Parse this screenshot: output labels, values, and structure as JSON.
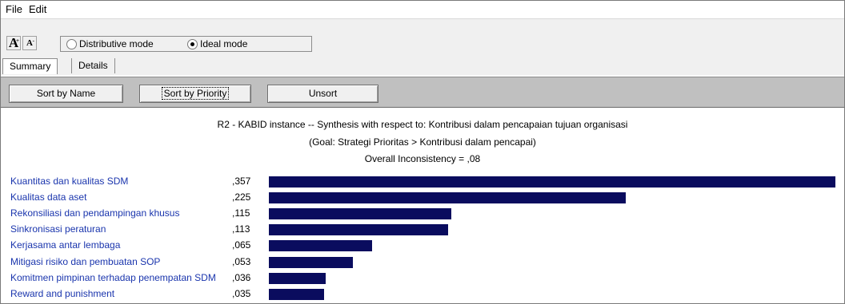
{
  "menu": {
    "file": "File",
    "edit": "Edit"
  },
  "toolbar": {
    "font_increase_icon": "A-increase-font-icon",
    "font_decrease_icon": "A-decrease-font-icon",
    "mode_distributive": "Distributive mode",
    "mode_ideal": "Ideal mode",
    "selected_mode": "Ideal mode"
  },
  "tabs": {
    "summary": "Summary",
    "details": "Details",
    "active": "Summary"
  },
  "sort": {
    "by_name": "Sort by Name",
    "by_priority": "Sort by Priority",
    "unsort": "Unsort"
  },
  "header": {
    "line1": "R2 - KABID instance -- Synthesis with respect to: Kontribusi dalam pencapaian tujuan organisasi",
    "line2": "(Goal: Strategi Prioritas  > Kontribusi dalam pencapai)",
    "line3": "Overall Inconsistency = ,08"
  },
  "colors": {
    "bar": "#0a0c5e",
    "label": "#1a35ad",
    "sortbar": "#c0c0c0"
  },
  "chart_data": {
    "type": "bar",
    "orientation": "horizontal",
    "categories": [
      "Kuantitas dan kualitas SDM",
      "Kualitas data aset",
      "Rekonsiliasi dan pendampingan khusus",
      "Sinkronisasi peraturan",
      "Kerjasama antar lembaga",
      "Mitigasi risiko dan pembuatan SOP",
      "Komitmen pimpinan terhadap penempatan SDM",
      "Reward and punishment"
    ],
    "labels": [
      ",357",
      ",225",
      ",115",
      ",113",
      ",065",
      ",053",
      ",036",
      ",035"
    ],
    "values": [
      0.357,
      0.225,
      0.115,
      0.113,
      0.065,
      0.053,
      0.036,
      0.035
    ]
  }
}
